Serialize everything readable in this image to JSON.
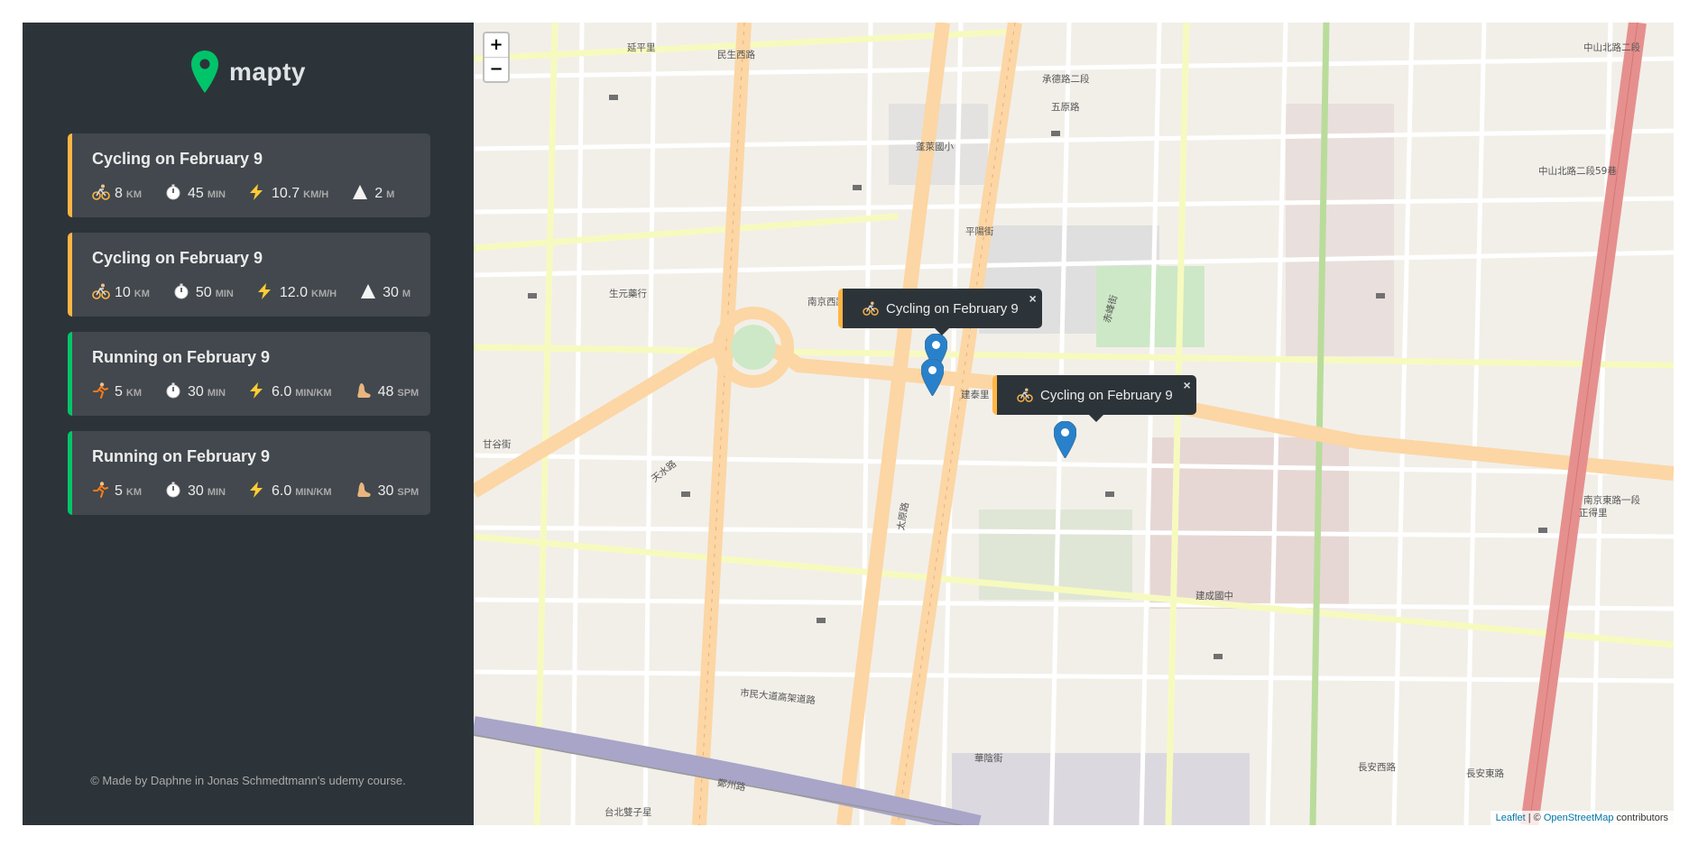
{
  "app": {
    "name": "mapty"
  },
  "workouts": [
    {
      "type": "cycling",
      "title": "Cycling on February 9",
      "distance": "8",
      "distance_unit": "km",
      "duration": "45",
      "duration_unit": "min",
      "speed": "10.7",
      "speed_unit": "km/h",
      "extra": "2",
      "extra_unit": "m"
    },
    {
      "type": "cycling",
      "title": "Cycling on February 9",
      "distance": "10",
      "distance_unit": "km",
      "duration": "50",
      "duration_unit": "min",
      "speed": "12.0",
      "speed_unit": "km/h",
      "extra": "30",
      "extra_unit": "m"
    },
    {
      "type": "running",
      "title": "Running on February 9",
      "distance": "5",
      "distance_unit": "km",
      "duration": "30",
      "duration_unit": "min",
      "speed": "6.0",
      "speed_unit": "min/km",
      "extra": "48",
      "extra_unit": "spm"
    },
    {
      "type": "running",
      "title": "Running on February 9",
      "distance": "5",
      "distance_unit": "km",
      "duration": "30",
      "duration_unit": "min",
      "speed": "6.0",
      "speed_unit": "min/km",
      "extra": "30",
      "extra_unit": "spm"
    }
  ],
  "copyright": "© Made by Daphne in Jonas Schmedtmann's udemy course.",
  "map": {
    "zoom_in": "+",
    "zoom_out": "−",
    "popups": [
      {
        "text": "Cycling on February 9",
        "close": "×"
      },
      {
        "text": "Cycling on February 9",
        "close": "×"
      }
    ],
    "attribution": {
      "leaflet": "Leaflet",
      "sep": " | © ",
      "osm": "OpenStreetMap",
      "suffix": " contributors"
    },
    "labels": [
      "民生西路",
      "南京西路",
      "中山北路二段",
      "承德路二段",
      "市民大道高架道路",
      "台北雙子星",
      "生元藥行",
      "甘谷街",
      "華陰街",
      "天水路",
      "太原路",
      "長安西路",
      "長安東路",
      "正得里",
      "南京東路一段",
      "中山北路二段59巷",
      "鄭州路",
      "建成國中",
      "平陽街",
      "赤峰街",
      "五原路",
      "蓬萊國小",
      "建泰里",
      "延平里"
    ]
  },
  "colors": {
    "cycling": "#ffb545",
    "running": "#00c46a",
    "sidebar": "#2d3439",
    "card": "#42484d",
    "marker": "#2a81cb"
  }
}
